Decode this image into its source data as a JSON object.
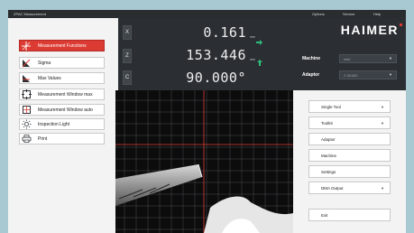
{
  "titlebar": {
    "app_title": "ZPAC Measurement",
    "menu": [
      "Options",
      "Service",
      "Help"
    ]
  },
  "left_panel": {
    "items": [
      {
        "label": "Measurement Functions",
        "icon": "crosshair-icon",
        "active": true
      },
      {
        "label": "Sigma",
        "icon": "sigma-icon",
        "active": false
      },
      {
        "label": "Max Values",
        "icon": "max-values-icon",
        "active": false
      },
      {
        "label": "Measurement Window max",
        "icon": "window-max-icon",
        "active": false
      },
      {
        "label": "Measurement Window auto",
        "icon": "window-auto-icon",
        "active": false
      },
      {
        "label": "Inspection Light",
        "icon": "light-icon",
        "active": false
      },
      {
        "label": "Print",
        "icon": "printer-icon",
        "active": false
      }
    ]
  },
  "readout": {
    "axes": [
      {
        "axis": "X",
        "value": "0.161",
        "unit": "mm"
      },
      {
        "axis": "Z",
        "value": "153.446",
        "unit": "mm"
      },
      {
        "axis": "C",
        "value": "90.000°",
        "unit": ""
      }
    ]
  },
  "header_right": {
    "logo": "HAIMER",
    "machine_label": "Machine",
    "machine_value": "intel",
    "adaptor_label": "Adaptor",
    "adaptor_value": "2 SK663"
  },
  "right_panel": {
    "buttons": [
      {
        "label": "Single Tool",
        "dropdown": true
      },
      {
        "label": "Toolkit",
        "dropdown": true
      },
      {
        "label": "Adaptor",
        "dropdown": false
      },
      {
        "label": "Machine",
        "dropdown": false
      },
      {
        "label": "Settings",
        "dropdown": false
      },
      {
        "label": "DMA Output",
        "dropdown": true
      },
      {
        "label": "Exit",
        "dropdown": false
      }
    ]
  },
  "colors": {
    "accent_red": "#dc3b33",
    "arrow_green": "#2ebd7c",
    "dark_panel": "#2b2f33"
  }
}
